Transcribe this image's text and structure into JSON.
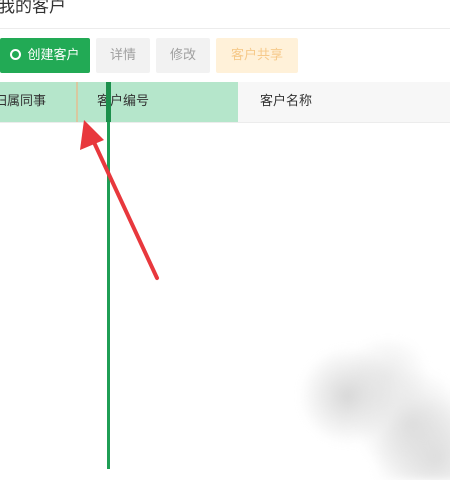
{
  "page": {
    "title": "我的客户"
  },
  "toolbar": {
    "create_label": "创建客户",
    "detail_label": "详情",
    "edit_label": "修改",
    "share_label": "客户共享"
  },
  "table": {
    "columns": [
      "归属同事",
      "客户编号",
      "客户名称"
    ]
  },
  "colors": {
    "primary_green": "#22aa55",
    "selected_column": "#b5e6cb",
    "resize_line": "#1f9e55",
    "share_button_bg": "#fff1d9",
    "arrow": "#e8383d"
  },
  "icons": {
    "create_button_icon": "circle-icon"
  }
}
